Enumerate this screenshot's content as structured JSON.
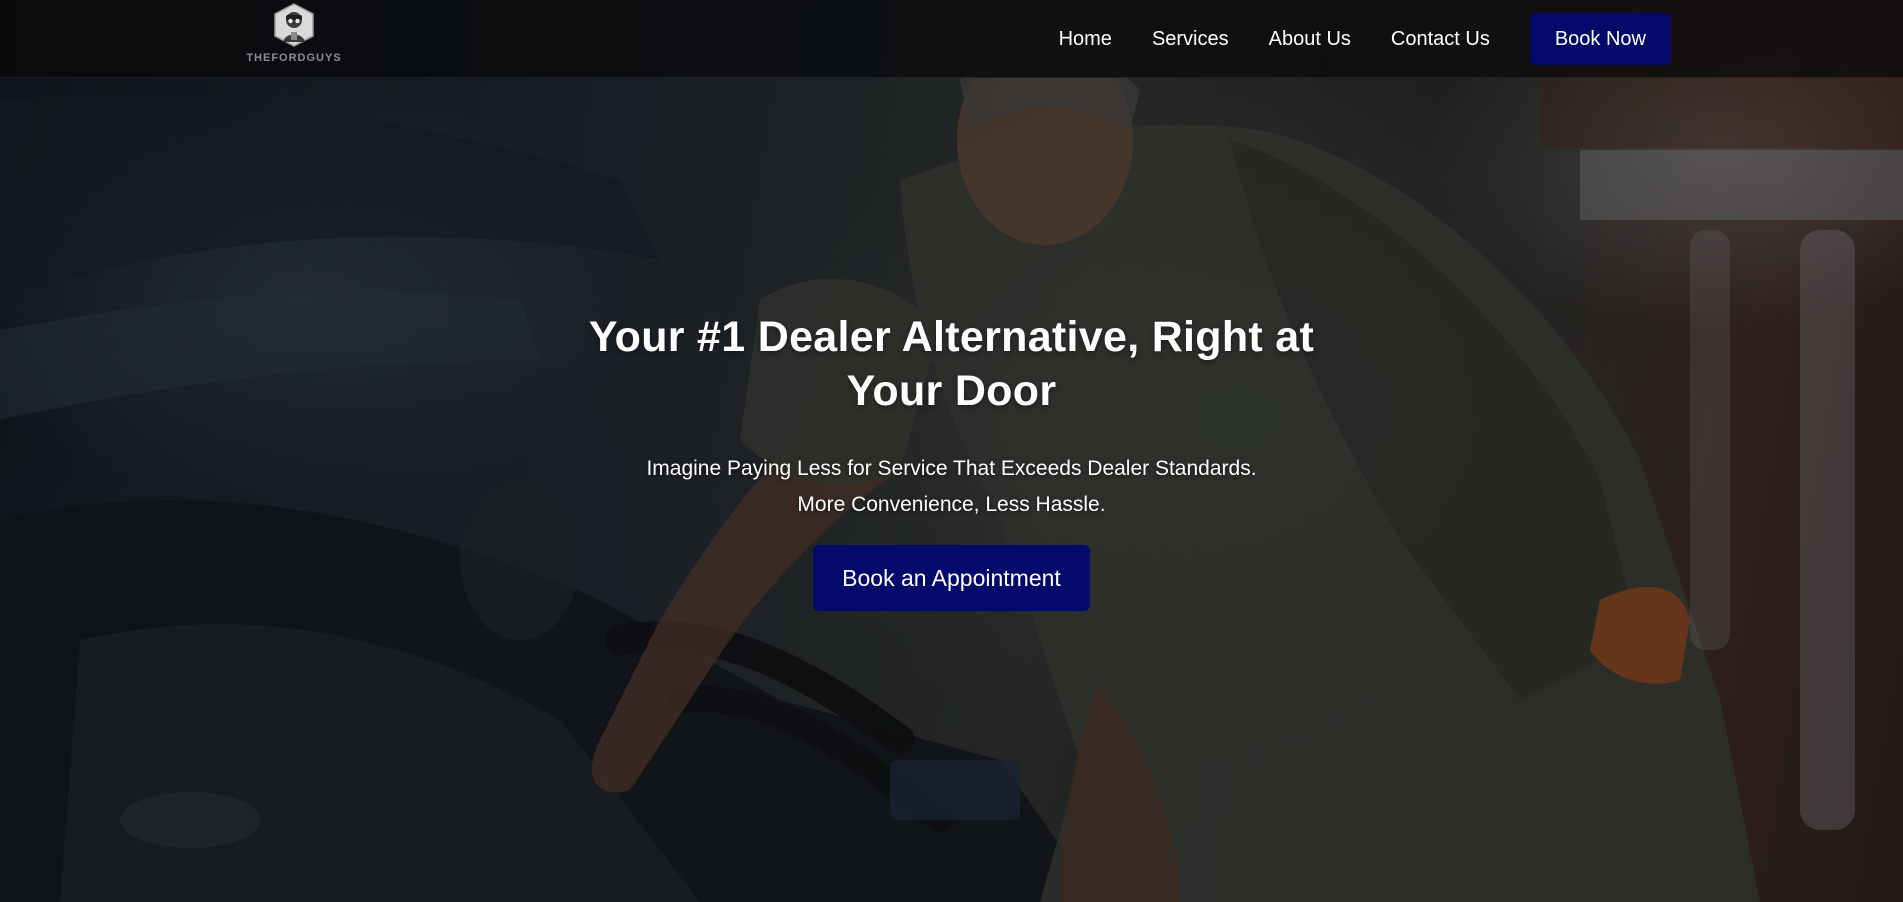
{
  "header": {
    "logo_text": "THEFORDGUYS",
    "nav": {
      "home": "Home",
      "services": "Services",
      "about": "About Us",
      "contact": "Contact Us"
    },
    "cta_label": "Book Now"
  },
  "hero": {
    "title": "Your #1 Dealer Alternative, Right at Your Door",
    "subtitle_line1": "Imagine Paying Less for Service That Exceeds Dealer Standards.",
    "subtitle_line2": "More Convenience, Less Hassle.",
    "cta_label": "Book an Appointment",
    "background_icon": "mechanic-photo"
  },
  "colors": {
    "accent": "#040a6b",
    "text": "#ffffff",
    "header_bg": "#0a0c0e"
  }
}
